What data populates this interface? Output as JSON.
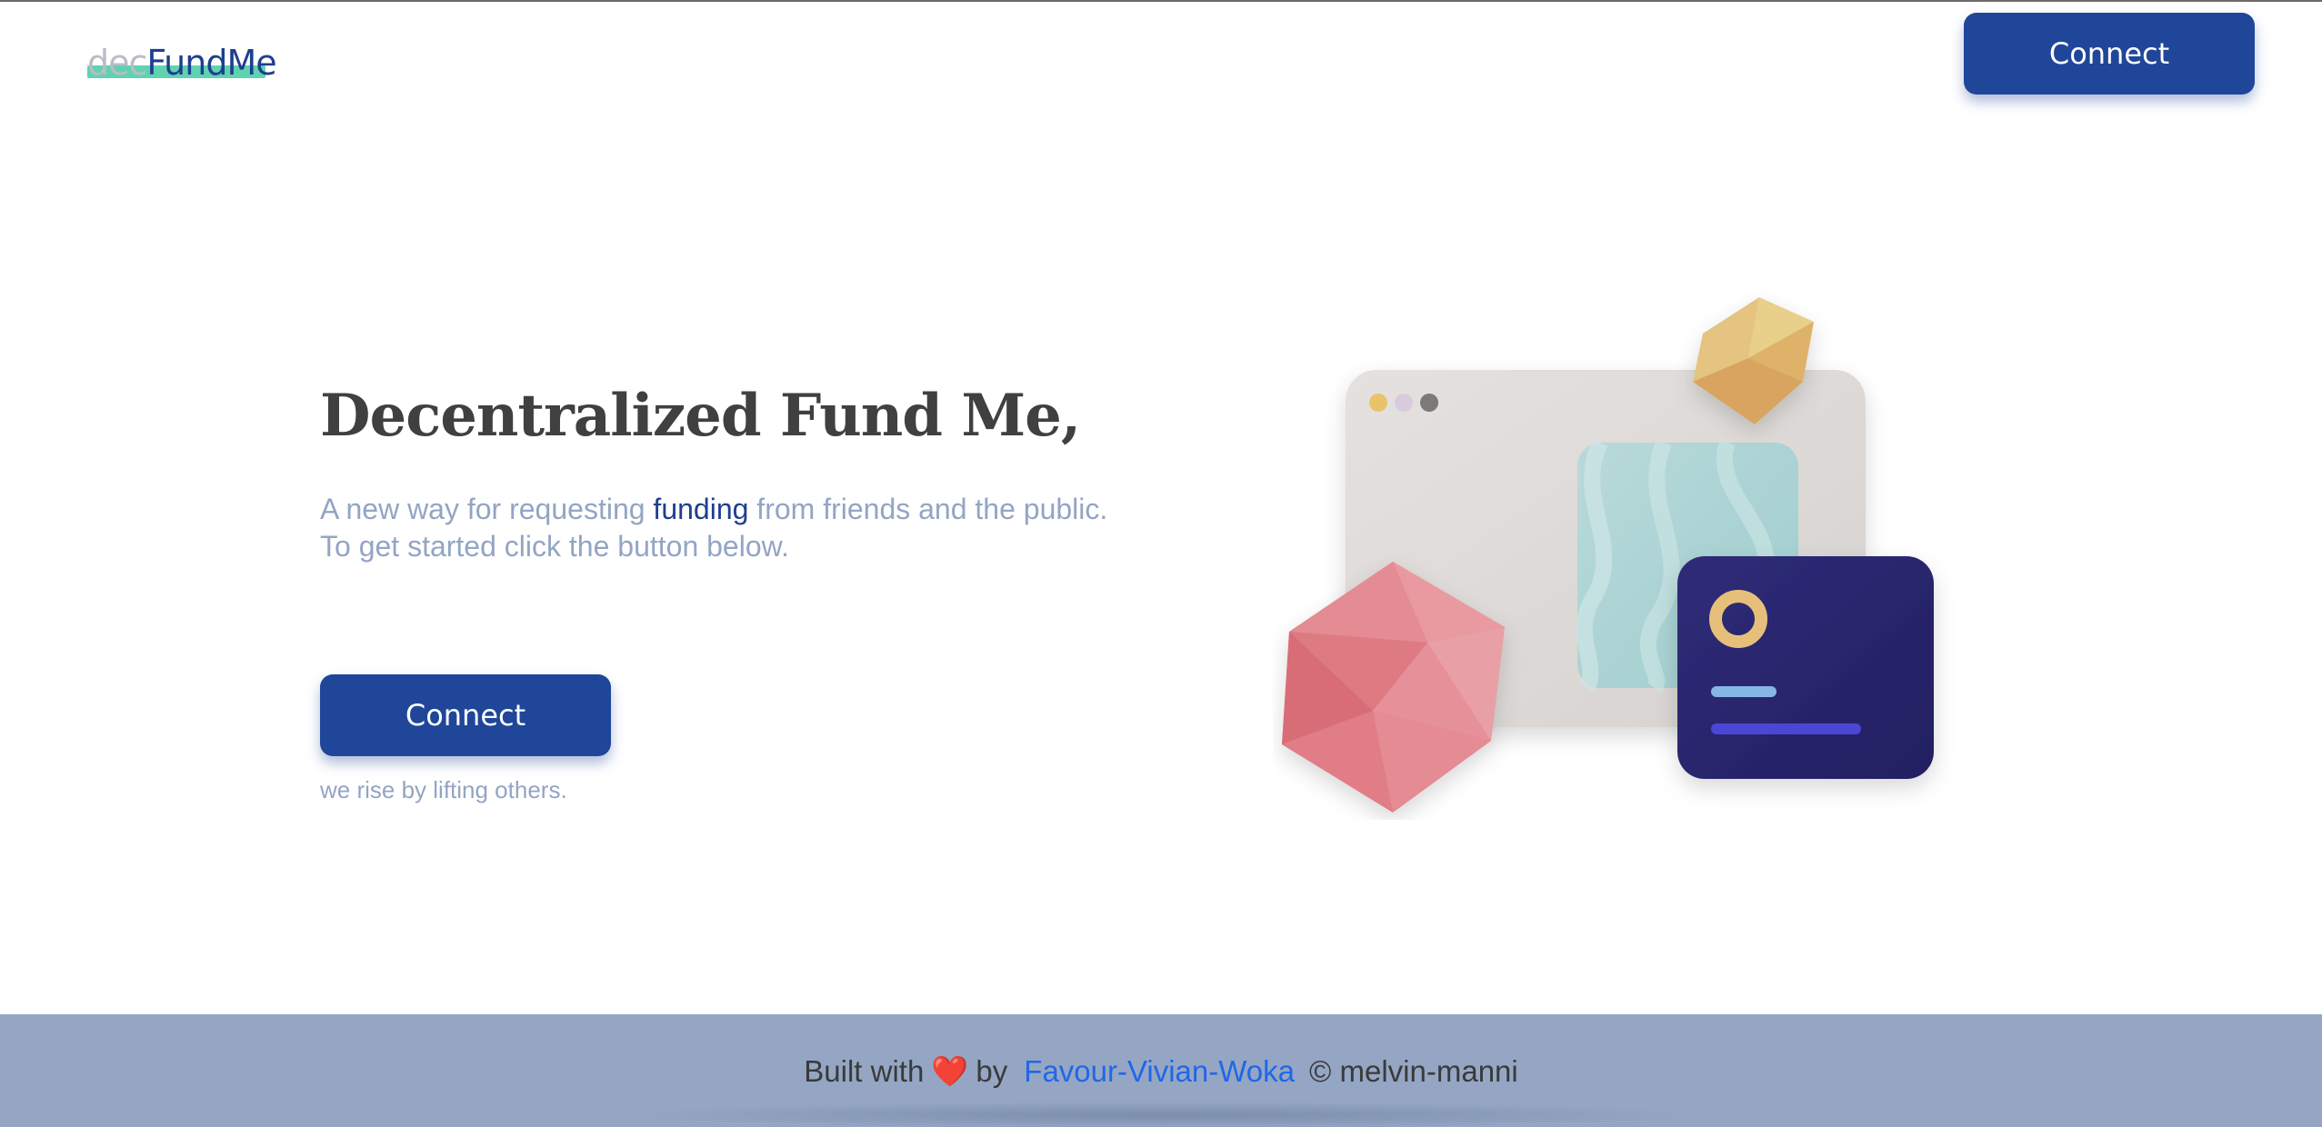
{
  "header": {
    "logo_prefix": "dec",
    "logo_main": "FundMe",
    "connect_label": "Connect"
  },
  "hero": {
    "title": "Decentralized Fund Me,",
    "subtitle_part1": "A new way for requesting ",
    "subtitle_highlight": "funding",
    "subtitle_part2": " from friends and the public.",
    "subtitle_line2": "To get started click the button below.",
    "connect_label": "Connect",
    "motto": "we rise by lifting others."
  },
  "footer": {
    "built_with": "Built with",
    "heart": "❤️",
    "by": "by",
    "author": "Favour-Vivian-Woka",
    "copyright": "© melvin-manni"
  },
  "colors": {
    "primary": "#1f4699",
    "logo_highlight": "#5fd3b0",
    "muted_text": "#93a5c4",
    "footer_bg": "#94a6c4",
    "link": "#2167e8"
  }
}
